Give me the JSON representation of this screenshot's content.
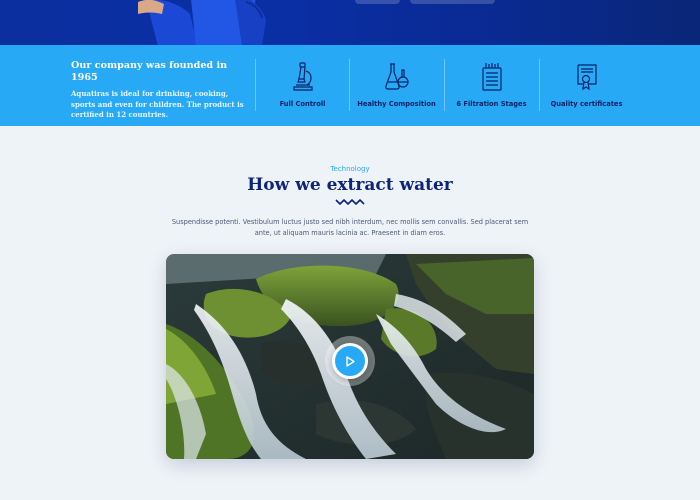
{
  "about": {
    "title": "Our company was founded in 1965",
    "text": "Aquatiras is ideal for drinking, cooking, sports and even for children. The product is certified in 12 countries."
  },
  "features": [
    {
      "label": "Full Controll",
      "icon": "microscope-icon"
    },
    {
      "label": "Healthy Composition",
      "icon": "flasks-icon"
    },
    {
      "label": "6 Filtration Stages",
      "icon": "filter-icon"
    },
    {
      "label": "Quality certificates",
      "icon": "certificate-icon"
    }
  ],
  "technology": {
    "eyebrow": "Technology",
    "title": "How we extract water",
    "text": "Suspendisse potenti. Vestibulum luctus justo sed nibh interdum, nec mollis sem convallis. Sed placerat sem ante, ut aliquam mauris lacinia ac. Praesent in diam eros."
  },
  "video": {
    "icon": "play-icon"
  },
  "colors": {
    "hero": "#0a2fa5",
    "band": "#27a9f6",
    "heading": "#0f2478",
    "accent": "#27a9f6",
    "background": "#eef3f7"
  }
}
